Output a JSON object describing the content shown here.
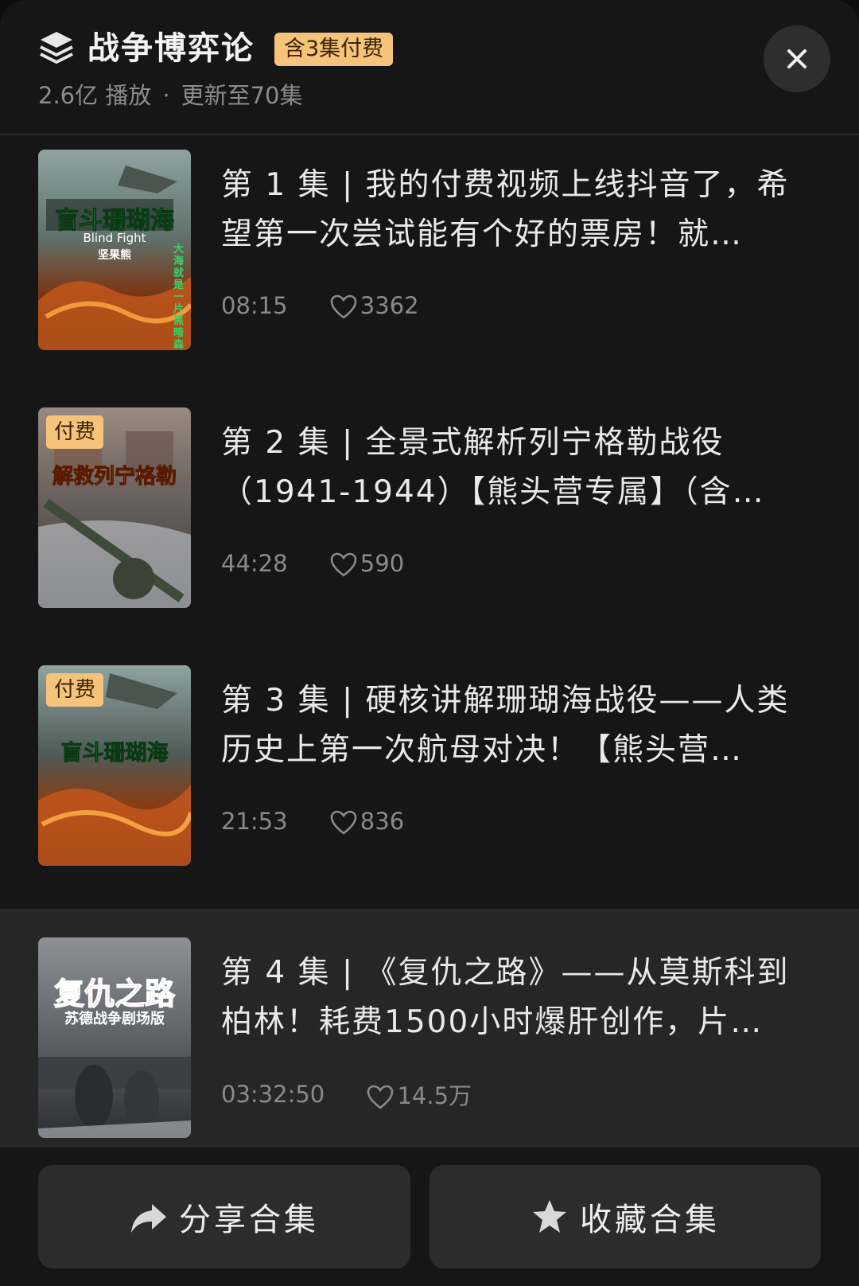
{
  "header": {
    "title": "战争博弈论",
    "paid_badge": "含3集付费",
    "plays": "2.6亿 播放",
    "separator": "·",
    "update": "更新至70集"
  },
  "episodes": [
    {
      "title": "第 1 集 | 我的付费视频上线抖音了，希望第一次尝试能有个好的票房！就…",
      "duration": "08:15",
      "likes": "3362",
      "paid_tag": "",
      "thumb_text": "盲斗珊瑚海",
      "thumb_sub": "Blind Fight",
      "thumb_sub2": "坚果熊",
      "thumb_vertical": "大海就是一片黑暗森林"
    },
    {
      "title": "第 2 集 | 全景式解析列宁格勒战役（1941-1944）【熊头营专属】（含…",
      "duration": "44:28",
      "likes": "590",
      "paid_tag": "付费",
      "thumb_text": "解救列宁格勒"
    },
    {
      "title": "第 3 集 | 硬核讲解珊瑚海战役——人类历史上第一次航母对决！【熊头营…",
      "duration": "21:53",
      "likes": "836",
      "paid_tag": "付费",
      "thumb_text": "盲斗珊瑚海"
    },
    {
      "title": "第 4 集 | 《复仇之路》——从莫斯科到柏林！耗费1500小时爆肝创作，片…",
      "duration": "03:32:50",
      "likes": "14.5万",
      "paid_tag": "",
      "thumb_text": "复仇之路",
      "thumb_sub": "苏德战争剧场版"
    }
  ],
  "footer": {
    "share_label": "分享合集",
    "fav_label": "收藏合集"
  },
  "colors": {
    "background": "#161616",
    "badge": "#f5c37a",
    "active_row": "#262626",
    "button": "#2c2c2c"
  },
  "icons": {
    "header": "stack-layers-icon",
    "close": "close-icon",
    "likes": "heart-icon",
    "share": "share-arrow-icon",
    "favorite": "star-icon"
  }
}
